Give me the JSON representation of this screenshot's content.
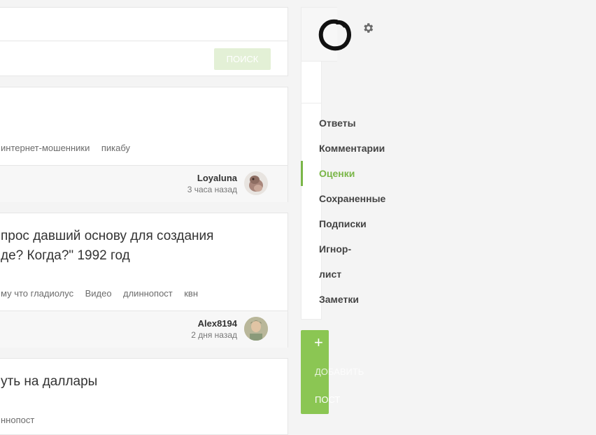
{
  "search": {
    "button_label": "ПОИСК"
  },
  "posts": [
    {
      "title_lines": [],
      "tags": [
        "интернет-мошенники",
        "пикабу"
      ],
      "author": "Loyaluna",
      "time": "3 часа назад"
    },
    {
      "title_lines": [
        "прос давший основу для создания",
        "де? Когда?\" 1992 год"
      ],
      "tags": [
        "му что гладиолус",
        "Видео",
        "длиннопост",
        "квн"
      ],
      "author": "Alex8194",
      "time": "2 дня назад"
    },
    {
      "title_lines": [
        "уть на даллары"
      ],
      "tags": [
        "ннопост"
      ]
    }
  ],
  "sidebar": {
    "settings_icon": "gear-icon",
    "logo_icon": "enso-circle-icon",
    "menu": [
      {
        "label": "Ответы",
        "active": false
      },
      {
        "label": "Комментарии",
        "active": false
      },
      {
        "label": "Оценки",
        "active": true
      },
      {
        "label": "Сохраненные",
        "active": false
      },
      {
        "label": "Подписки",
        "active": false
      },
      {
        "label": "Игнор-",
        "active": false
      },
      {
        "label": "лист",
        "active": false
      },
      {
        "label": "Заметки",
        "active": false
      }
    ],
    "add_post": {
      "plus": "+",
      "label_line1": "ДОБАВИТЬ",
      "label_line2": "ПОСТ"
    }
  },
  "colors": {
    "accent": "#7ab648",
    "accent_light": "#e3f0d6",
    "add_button": "#8bc653"
  }
}
